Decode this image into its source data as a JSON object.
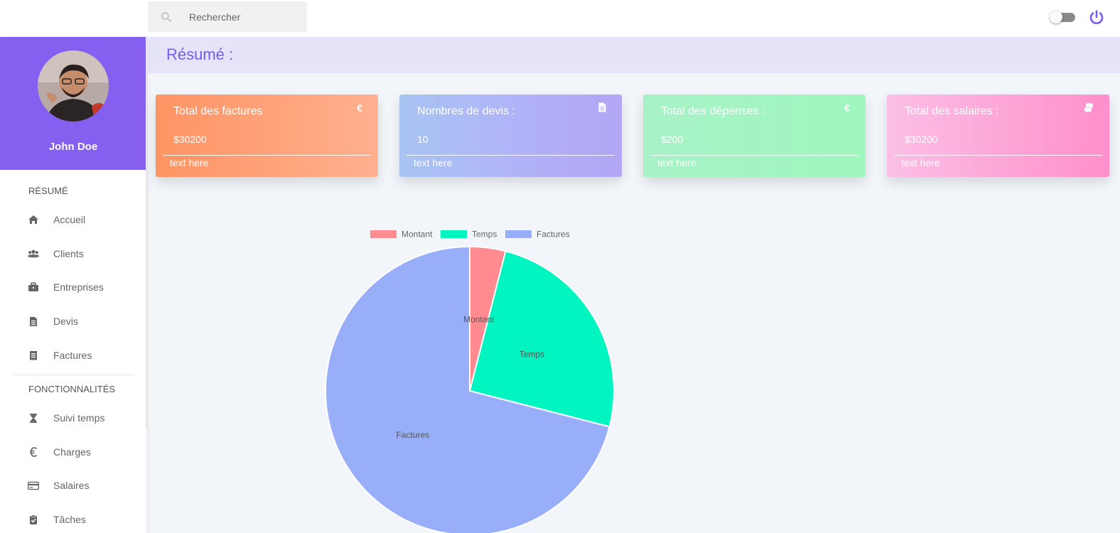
{
  "search": {
    "placeholder": "Rechercher"
  },
  "user": {
    "name": "John Doe"
  },
  "sidebar": {
    "section1_title": "RÉSUMÉ",
    "items1": [
      {
        "label": "Accueil",
        "icon": "home-icon"
      },
      {
        "label": "Clients",
        "icon": "users-icon"
      },
      {
        "label": "Entreprises",
        "icon": "briefcase-icon"
      },
      {
        "label": "Devis",
        "icon": "document-icon"
      },
      {
        "label": "Factures",
        "icon": "receipt-icon"
      }
    ],
    "section2_title": "FONCTIONNALITÉS",
    "items2": [
      {
        "label": "Suivi temps",
        "icon": "hourglass-icon"
      },
      {
        "label": "Charges",
        "icon": "euro-icon"
      },
      {
        "label": "Salaires",
        "icon": "credit-card-icon"
      },
      {
        "label": "Tâches",
        "icon": "clipboard-check-icon"
      }
    ]
  },
  "main": {
    "title": "Résumé :",
    "cards": [
      {
        "title": "Total des factures",
        "value": "$30200",
        "footer": "text here",
        "icon": "euro-icon"
      },
      {
        "title": "Nombres de devis :",
        "value": "10",
        "footer": "text here",
        "icon": "file-icon"
      },
      {
        "title": "Total des dépenses :",
        "value": "$200",
        "footer": "text here",
        "icon": "euro-icon"
      },
      {
        "title": "Total des salaires :",
        "value": "$30200",
        "footer": "text here",
        "icon": "coins-icon"
      }
    ]
  },
  "colors": {
    "accent": "#8560f0",
    "montant": "#ff8a8f",
    "temps": "#00f5c0",
    "factures": "#99aef8"
  },
  "chart_data": {
    "type": "pie",
    "categories": [
      "Montant",
      "Temps",
      "Factures"
    ],
    "values": [
      4,
      25,
      71
    ],
    "legend": "top",
    "labels_on_slices": true
  }
}
